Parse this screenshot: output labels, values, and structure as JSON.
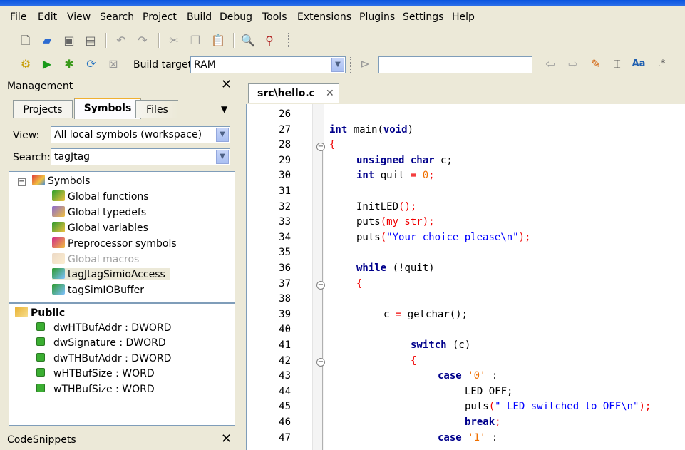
{
  "menu": [
    "File",
    "Edit",
    "View",
    "Search",
    "Project",
    "Build",
    "Debug",
    "Tools",
    "Extensions",
    "Plugins",
    "Settings",
    "Help"
  ],
  "toolbar": {
    "build_target_label": "Build target:",
    "build_target_value": "RAM",
    "search_value": ""
  },
  "management": {
    "title": "Management",
    "close_glyph": "✕",
    "tabs": [
      "Projects",
      "Symbols",
      "Files"
    ],
    "active_tab": "Symbols",
    "view_label": "View:",
    "view_value": "All local symbols (workspace)",
    "search_label": "Search:",
    "search_value": "tagJtag",
    "tree": [
      {
        "label": "Symbols",
        "icon": "symbols-folder-icon"
      },
      {
        "label": "Global functions",
        "icon": "functions-folder-icon"
      },
      {
        "label": "Global typedefs",
        "icon": "typedefs-folder-icon"
      },
      {
        "label": "Global variables",
        "icon": "variables-folder-icon"
      },
      {
        "label": "Preprocessor symbols",
        "icon": "preprocessor-folder-icon"
      },
      {
        "label": "Global macros",
        "icon": "macros-folder-icon"
      },
      {
        "label": "tagJtagSimioAccess",
        "icon": "class-icon"
      },
      {
        "label": "tagSimIOBuffer",
        "icon": "class-icon"
      }
    ],
    "public": {
      "title": "Public",
      "members": [
        "dwHTBufAddr : DWORD",
        "dwSignature : DWORD",
        "dwTHBufAddr : DWORD",
        "wHTBufSize : WORD",
        "wTHBufSize : WORD"
      ]
    }
  },
  "snippets": {
    "title": "CodeSnippets",
    "close_glyph": "✕"
  },
  "editor": {
    "tab_label": "src\\hello.c",
    "tab_close_glyph": "✕",
    "line_numbers": [
      "26",
      "27",
      "28",
      "29",
      "30",
      "31",
      "32",
      "33",
      "34",
      "35",
      "36",
      "37",
      "38",
      "39",
      "40",
      "41",
      "42",
      "43",
      "44",
      "45",
      "46",
      "47"
    ],
    "code": {
      "l27_kw1": "int",
      "l27_rest": " main(",
      "l27_kw2": "void",
      "l27_end": ")",
      "l28": "{",
      "l29_kw": "unsigned char",
      "l29_rest": " c;",
      "l30_kw": "int",
      "l30_rest": " quit ",
      "l30_eq": "=",
      "l30_num": " 0",
      "l30_end": ";",
      "l32_fn": "InitLED",
      "l32_rest": "();",
      "l33_fn": "puts",
      "l33_rest": "(my_str);",
      "l34_fn": "puts",
      "l34_open": "(",
      "l34_str": "\"Your choice please\\n\"",
      "l34_end": ");",
      "l36_kw": "while",
      "l36_rest": " (!quit)",
      "l37": "{",
      "l39_var": "c ",
      "l39_eq": "=",
      "l39_rest": " getchar();",
      "l41_kw": "switch",
      "l41_rest": " (c)",
      "l42": "{",
      "l43_kw": "case",
      "l43_str": " '0'",
      "l43_end": " :",
      "l44": "LED_OFF;",
      "l45_fn": "puts",
      "l45_open": "(",
      "l45_str": "\" LED switched to OFF\\n\"",
      "l45_end": ");",
      "l46_kw": "break",
      "l46_end": ";",
      "l47_kw": "case",
      "l47_str": " '1'",
      "l47_end": " :"
    }
  }
}
